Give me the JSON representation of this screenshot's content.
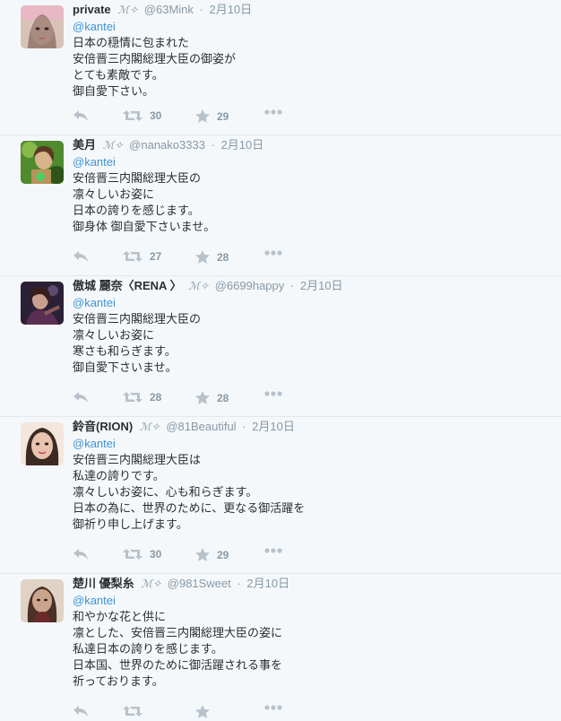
{
  "tweets": [
    {
      "name": "private",
      "verified_mark": "ℳ✧",
      "handle": "@63Mink",
      "time": "2月10日",
      "mention": "@kantei",
      "lines": [
        "日本の穏情に包まれた",
        "安倍晋三内閣総理大臣の御姿が",
        "とても素敵です。",
        "御自愛下さい。"
      ],
      "retweets": "30",
      "favorites": "29",
      "avatar_colors": [
        "#d7c2b7",
        "#6d4a3d",
        "#f0dcd2"
      ]
    },
    {
      "name": "美月",
      "verified_mark": "ℳ✧",
      "handle": "@nanako3333",
      "time": "2月10日",
      "mention": "@kantei",
      "lines": [
        "安倍晋三内閣総理大臣の",
        "凛々しいお姿に",
        "日本の誇りを感じます。",
        "御身体 御自愛下さいませ。"
      ],
      "retweets": "27",
      "favorites": "28",
      "avatar_colors": [
        "#4f8b2e",
        "#b9935b",
        "#2e5419"
      ]
    },
    {
      "name": "傲城 麗奈〈RENA 〉",
      "verified_mark": "ℳ✧",
      "handle": "@6699happy",
      "time": "2月10日",
      "mention": "@kantei",
      "lines": [
        "安倍晋三内閣総理大臣の",
        "凛々しいお姿に",
        "寒さも和らぎます。",
        "御自愛下さいませ。"
      ],
      "retweets": "28",
      "favorites": "28",
      "avatar_colors": [
        "#2b2035",
        "#8a5a5a",
        "#5b2f52"
      ]
    },
    {
      "name": "鈴音(RION)",
      "verified_mark": "ℳ✧",
      "handle": "@81Beautiful",
      "time": "2月10日",
      "mention": "@kantei",
      "lines": [
        "安倍晋三内閣総理大臣は",
        "私達の誇りです。",
        "凛々しいお姿に、心も和らぎます。",
        "日本の為に、世界のために、更なる御活躍を",
        "御祈り申し上げます。"
      ],
      "retweets": "30",
      "favorites": "29",
      "avatar_colors": [
        "#f2e6dd",
        "#3c2a22",
        "#e8c3b0"
      ]
    },
    {
      "name": "楚川 優梨糸",
      "verified_mark": "ℳ✧",
      "handle": "@981Sweet",
      "time": "2月10日",
      "mention": "@kantei",
      "lines": [
        "和やかな花と供に",
        "凛とした、安倍晋三内閣総理大臣の姿に",
        "私達日本の誇りを感じます。",
        "日本国、世界のために御活躍される事を",
        "祈っております。"
      ],
      "retweets": "",
      "favorites": "",
      "avatar_colors": [
        "#e0d2c4",
        "#4a3026",
        "#caa58c"
      ]
    }
  ]
}
